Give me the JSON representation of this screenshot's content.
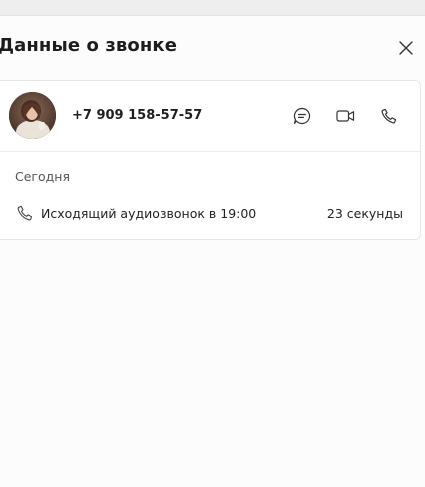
{
  "header": {
    "title": "Данные о звонке"
  },
  "contact": {
    "phone": "+7 909 158-57-57"
  },
  "history": {
    "section_label": "Сегодня",
    "calls": [
      {
        "description": "Исходящий аудиозвонок в 19:00",
        "duration": "23 секунды"
      }
    ]
  },
  "icons": {
    "close": "close-icon",
    "chat": "chat-icon",
    "video": "video-camera-icon",
    "call": "phone-icon",
    "call_type": "phone-icon"
  },
  "colors": {
    "background": "#fcfcfc",
    "card": "#ffffff",
    "border": "#e6e6e6",
    "text": "#1f1f1f",
    "muted": "#555555"
  }
}
